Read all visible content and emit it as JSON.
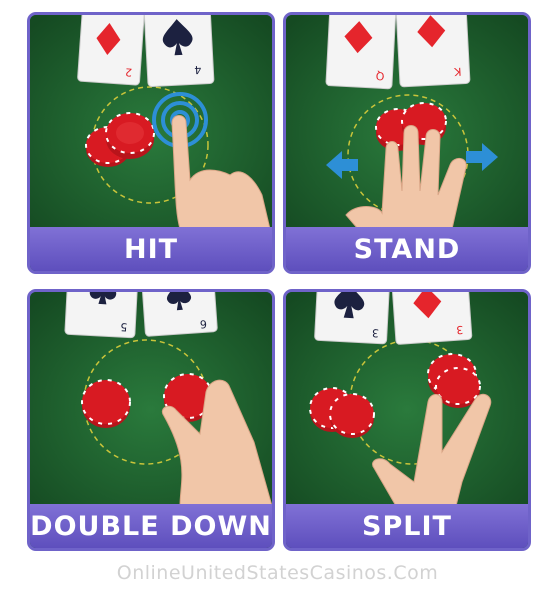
{
  "panels": {
    "hit": {
      "label": "HIT",
      "cards": [
        {
          "rank": "2",
          "suit": "diamond"
        },
        {
          "rank": "4",
          "suit": "spade"
        }
      ]
    },
    "stand": {
      "label": "STAND",
      "cards": [
        {
          "rank": "Q",
          "suit": "diamond"
        },
        {
          "rank": "K",
          "suit": "diamond"
        }
      ]
    },
    "double_down": {
      "label": "DOUBLE DOWN",
      "cards": [
        {
          "rank": "5",
          "suit": "club"
        },
        {
          "rank": "6",
          "suit": "spade"
        }
      ]
    },
    "split": {
      "label": "SPLIT",
      "cards": [
        {
          "rank": "3",
          "suit": "spade"
        },
        {
          "rank": "3",
          "suit": "diamond"
        }
      ]
    }
  },
  "watermark": "OnlineUnitedStatesCasinos.Com",
  "colors": {
    "felt": "#1f5c2e",
    "label_bar": "#6f5fcf",
    "chip_red": "#d81a22",
    "diamond_red": "#e5252c",
    "arrow_blue": "#2d8fd6"
  },
  "icons": [
    "tap-icon",
    "swipe-arrows-icon"
  ]
}
